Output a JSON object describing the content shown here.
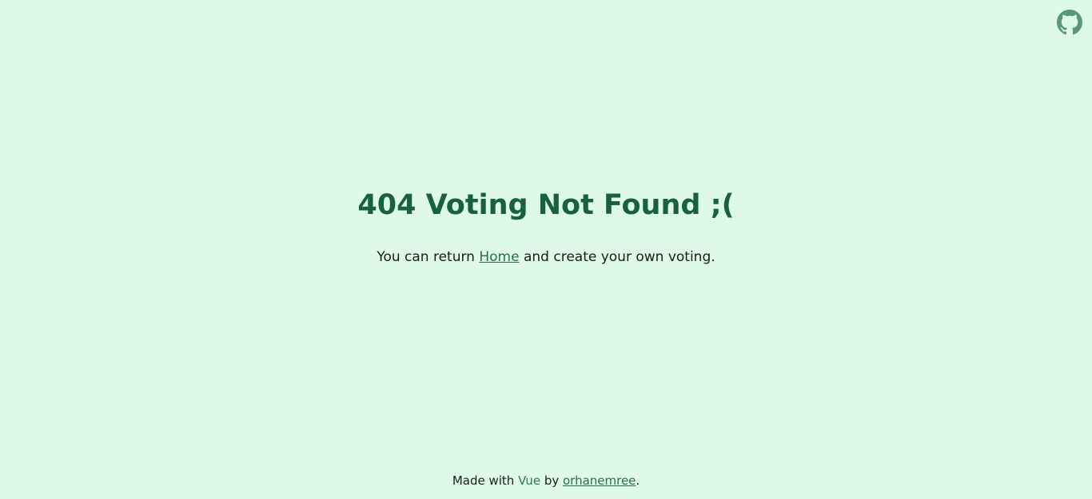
{
  "header": {
    "github_icon": "github-icon"
  },
  "main": {
    "title": "404 Voting Not Found ;(",
    "message_before": "You can return ",
    "home_link": "Home",
    "message_after": " and create your own voting."
  },
  "footer": {
    "made_with": "Made with ",
    "framework": "Vue",
    "by": " by ",
    "author": "orhanemree",
    "period": "."
  },
  "colors": {
    "background": "#defae7",
    "title": "#17623a",
    "link": "#2a6f45",
    "icon": "#5a9a72"
  }
}
